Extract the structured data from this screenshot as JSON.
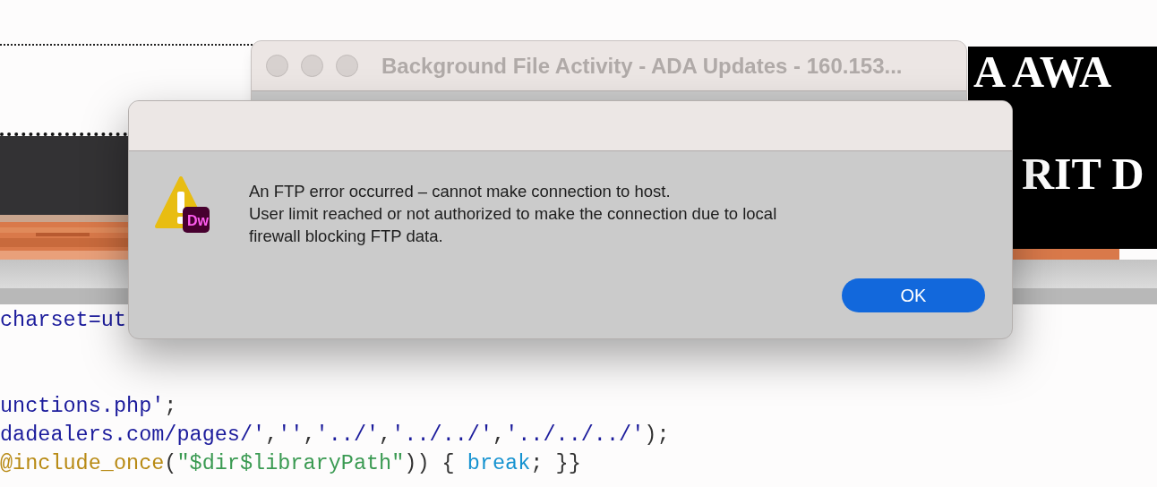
{
  "back_window": {
    "title": "Background File Activity - ADA Updates - 160.153..."
  },
  "banner": {
    "lines": [
      "A AWA",
      "RIT D"
    ]
  },
  "dialog": {
    "message_lines": [
      "An FTP error occurred – cannot make connection to host.",
      "User limit reached or not authorized to make the connection due to local",
      "firewall blocking FTP data."
    ],
    "badge": "Dw",
    "buttons": [
      {
        "label": "OK",
        "default": true
      }
    ]
  },
  "code_lines": [
    {
      "segments": [
        {
          "text": "charset=ut",
          "kind": "string"
        }
      ]
    },
    {
      "segments": [
        {
          "text": "unctions.php'",
          "kind": "string"
        },
        {
          "text": ";",
          "kind": "plain"
        }
      ]
    },
    {
      "segments": [
        {
          "text": "dadealers.com/pages/'",
          "kind": "string"
        },
        {
          "text": ",",
          "kind": "plain"
        },
        {
          "text": "''",
          "kind": "string"
        },
        {
          "text": ",",
          "kind": "plain"
        },
        {
          "text": "'../'",
          "kind": "string"
        },
        {
          "text": ",",
          "kind": "plain"
        },
        {
          "text": "'../../'",
          "kind": "string"
        },
        {
          "text": ",",
          "kind": "plain"
        },
        {
          "text": "'../../../'",
          "kind": "string"
        },
        {
          "text": ");",
          "kind": "plain"
        }
      ]
    },
    {
      "segments": [
        {
          "text": "@include_once",
          "kind": "function"
        },
        {
          "text": "(",
          "kind": "plain"
        },
        {
          "text": "\"$dir$libraryPath\"",
          "kind": "variable"
        },
        {
          "text": ")) { ",
          "kind": "plain"
        },
        {
          "text": "break",
          "kind": "keyword"
        },
        {
          "text": "; }}",
          "kind": "plain"
        }
      ]
    }
  ]
}
